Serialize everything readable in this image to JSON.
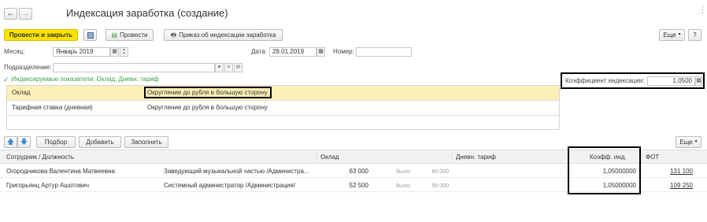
{
  "window": {
    "title": "Индексация заработка (создание)"
  },
  "toolbar": {
    "post_close": "Провести и закрыть",
    "post": "Провести",
    "print_order": "Приказ об индексации заработка",
    "more": "Еще"
  },
  "form": {
    "month_label": "Месяц:",
    "month_value": "Январь 2019",
    "date_label": "Дата:",
    "date_value": "28.01.2019",
    "number_label": "Номер:",
    "number_value": "",
    "department_label": "Подразделение:",
    "department_value": "",
    "indicators_label": "Индексируемые показатели: Оклад, Дневн. тариф",
    "coefficient_label": "Коэффициент индексации:",
    "coefficient_value": "1,0500"
  },
  "indicators": [
    {
      "name": "Оклад",
      "rounding": "Округление до рубля в большую сторону"
    },
    {
      "name": "Тарифная ставка (дневная)",
      "rounding": "Округление до рубля в большую сторону"
    }
  ],
  "table_toolbar": {
    "select": "Подбор",
    "add": "Добавить",
    "fill": "Заполнить",
    "more": "Еще"
  },
  "table": {
    "columns": {
      "employee": "Сотрудник / Должность",
      "salary": "Оклад",
      "daily_rate": "Дневн. тариф",
      "coefficient": "Коэфф. инд.",
      "payroll": "ФОТ"
    },
    "rows": [
      {
        "employee": "Огородникова Валентина Матвеевна",
        "position": "Заведующий музыкальной частью /Администра...",
        "salary": "63 000",
        "was_label": "было:",
        "was_value": "60 000",
        "coefficient": "1,05000000",
        "payroll": "131 100"
      },
      {
        "employee": "Григорьянц Артур Ашотович",
        "position": "Системный администратор /Администрация/",
        "salary": "52 500",
        "was_label": "было:",
        "was_value": "50 000",
        "coefficient": "1,05000000",
        "payroll": "109 250"
      }
    ]
  },
  "colors": {
    "primary_button": "#fbe200",
    "selected_row": "#fdf0b7",
    "accent_green": "#3ba04a"
  }
}
